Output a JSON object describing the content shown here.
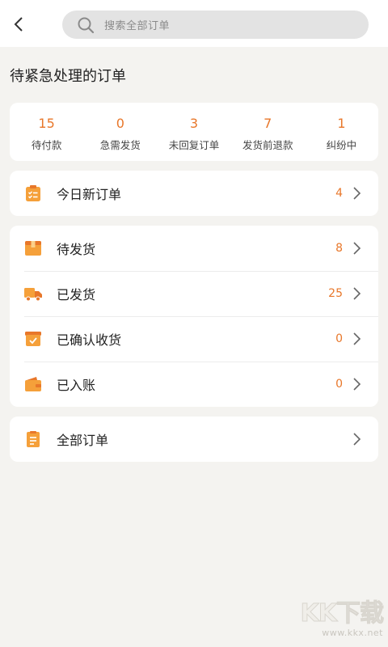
{
  "search": {
    "placeholder": "搜索全部订单"
  },
  "section_title": "待紧急处理的订单",
  "stats": [
    {
      "value": "15",
      "label": "待付款"
    },
    {
      "value": "0",
      "label": "急需发货"
    },
    {
      "value": "3",
      "label": "未回复订单"
    },
    {
      "value": "7",
      "label": "发货前退款"
    },
    {
      "value": "1",
      "label": "纠纷中"
    }
  ],
  "today": {
    "label": "今日新订单",
    "count": "4",
    "icon": "clipboard-list-icon"
  },
  "status_rows": [
    {
      "label": "待发货",
      "count": "8",
      "icon": "box-icon"
    },
    {
      "label": "已发货",
      "count": "25",
      "icon": "truck-icon"
    },
    {
      "label": "已确认收货",
      "count": "0",
      "icon": "check-box-icon"
    },
    {
      "label": "已入账",
      "count": "0",
      "icon": "wallet-icon"
    }
  ],
  "all_orders": {
    "label": "全部订单",
    "icon": "document-icon"
  },
  "watermark": {
    "logo": "KK下载",
    "url": "www.kkx.net"
  },
  "colors": {
    "accent": "#e8772a",
    "icon_orange": "#f5a03a",
    "background": "#f4f3f0"
  }
}
